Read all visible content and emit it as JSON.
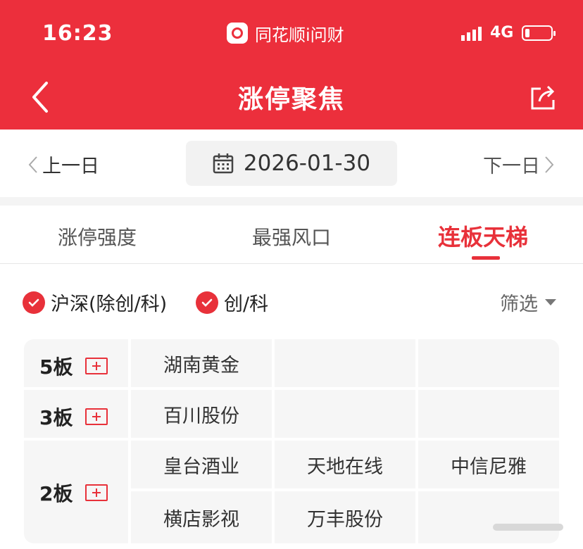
{
  "status_bar": {
    "time": "16:23",
    "app_name": "同花顺i问财",
    "network": "4G"
  },
  "header": {
    "title": "涨停聚焦",
    "back_icon": "chevron-left-icon",
    "share_icon": "share-icon"
  },
  "date_bar": {
    "prev_label": "上一日",
    "date": "2026-01-30",
    "next_label": "下一日"
  },
  "tabs": [
    {
      "label": "涨停强度",
      "active": false
    },
    {
      "label": "最强风口",
      "active": false
    },
    {
      "label": "连板天梯",
      "active": true
    }
  ],
  "filters": {
    "options": [
      {
        "label": "沪深(除创/科)",
        "checked": true
      },
      {
        "label": "创/科",
        "checked": true
      }
    ],
    "filter_label": "筛选"
  },
  "ladder": [
    {
      "level": "5板",
      "stocks": [
        [
          "湖南黄金",
          "",
          ""
        ]
      ]
    },
    {
      "level": "3板",
      "stocks": [
        [
          "百川股份",
          "",
          ""
        ]
      ]
    },
    {
      "level": "2板",
      "stocks": [
        [
          "皇台酒业",
          "天地在线",
          "中信尼雅"
        ],
        [
          "横店影视",
          "万丰股份",
          ""
        ]
      ]
    }
  ],
  "colors": {
    "header_red": "#ec2f3c",
    "accent_red": "#e8313a"
  }
}
